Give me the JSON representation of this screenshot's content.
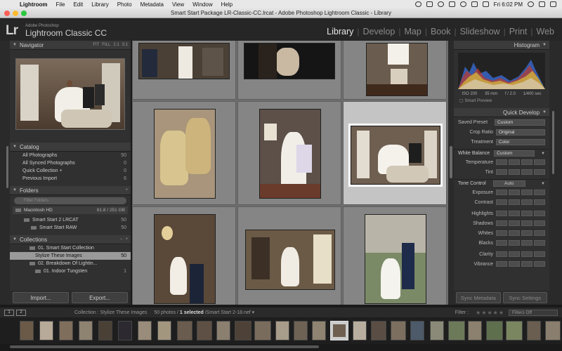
{
  "menubar": {
    "app_name": "Lightroom",
    "items": [
      "File",
      "Edit",
      "Library",
      "Photo",
      "Metadata",
      "View",
      "Window",
      "Help"
    ],
    "clock": "Fri 6:02 PM"
  },
  "window": {
    "title": "Smart Start Package LR-Classic-CC.lrcat - Adobe Photoshop Lightroom Classic - Library"
  },
  "identity": {
    "logo": "Lr",
    "brand_top": "Adobe Photoshop",
    "brand_name": "Lightroom Classic CC"
  },
  "modules": [
    "Library",
    "Develop",
    "Map",
    "Book",
    "Slideshow",
    "Print",
    "Web"
  ],
  "left": {
    "navigator": {
      "title": "Navigator",
      "zoom_options": [
        "FIT",
        "FILL",
        "1:1",
        "3:1"
      ]
    },
    "catalog": {
      "title": "Catalog",
      "items": [
        {
          "label": "All Photographs",
          "count": "50"
        },
        {
          "label": "All Synced Photographs",
          "count": "0"
        },
        {
          "label": "Quick Collection +",
          "count": "0"
        },
        {
          "label": "Previous Import",
          "count": "6"
        }
      ]
    },
    "folders": {
      "title": "Folders",
      "search_placeholder": "Filter Folders",
      "volume": {
        "name": "Macintosh HD",
        "size": "81.8 / 251 GB"
      },
      "items": [
        {
          "label": "Smart Start 2 LRCAT",
          "count": "50"
        },
        {
          "label": "Smart Start RAW",
          "count": "50"
        }
      ]
    },
    "collections": {
      "title": "Collections",
      "items": [
        {
          "label": "01. Smart Start Collection",
          "count": ""
        },
        {
          "label": "Stylize These Images",
          "count": "50"
        },
        {
          "label": "02. Breakdown Of Lightin...",
          "count": ""
        },
        {
          "label": "01. Indoor Tungsten",
          "count": "1"
        }
      ]
    },
    "import_label": "Import...",
    "export_label": "Export..."
  },
  "right": {
    "histogram_title": "Histogram",
    "exif": [
      "ISO 200",
      "35 mm",
      "f / 2.0",
      "1/400 sec"
    ],
    "smart_preview": "Smart Preview",
    "quick_develop_title": "Quick Develop",
    "saved_preset_label": "Saved Preset",
    "saved_preset_value": "Custom",
    "crop_ratio_label": "Crop Ratio",
    "crop_ratio_value": "Original",
    "treatment_label": "Treatment",
    "treatment_value": "Color",
    "white_balance_label": "White Balance",
    "white_balance_value": "Custom",
    "wb_controls": [
      "Temperature",
      "Tint"
    ],
    "tone_control_label": "Tone Control",
    "auto_label": "Auto",
    "tone_controls": [
      "Exposure",
      "Contrast",
      "Highlights",
      "Shadows",
      "Whites",
      "Blacks",
      "Clarity",
      "Vibrance"
    ],
    "sync_metadata_label": "Sync Metadata",
    "sync_settings_label": "Sync Settings"
  },
  "toolbar": {
    "monitor1": "1",
    "monitor2": "2",
    "collection_prefix": "Collection : Stylize These Images",
    "count_prefix": "50 photos /",
    "selected": "1 selected",
    "file": "/Smart Start 2-18.nef",
    "filter_label": "Filter :",
    "stars": "★★★★★",
    "filters_off": "Filters Off"
  }
}
